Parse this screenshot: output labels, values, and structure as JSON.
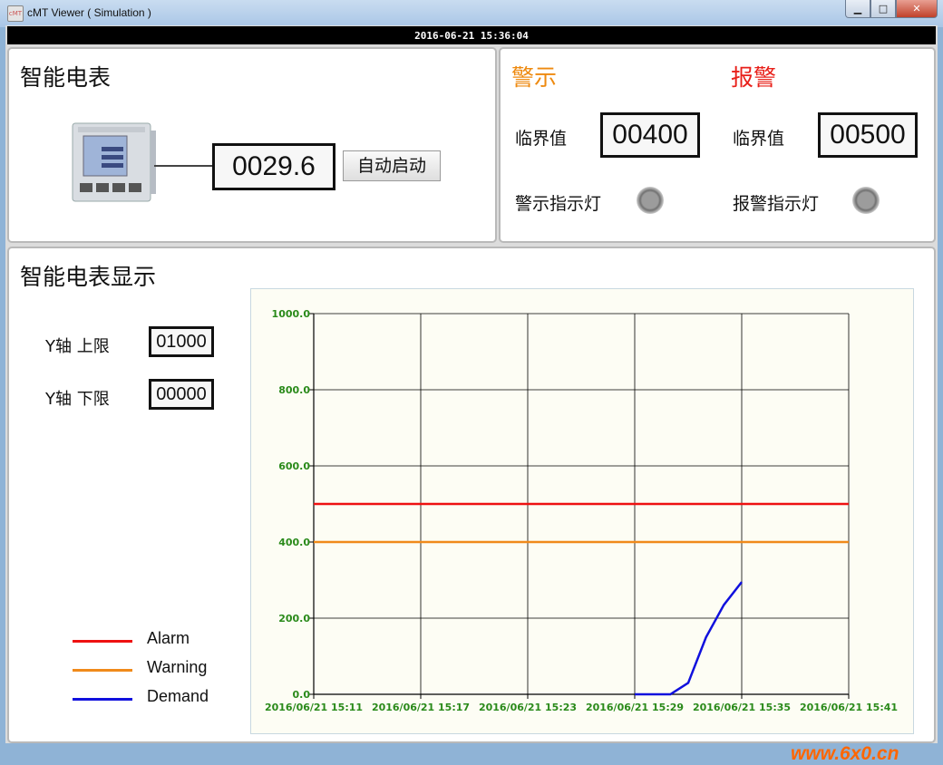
{
  "window": {
    "title": "cMT Viewer ( Simulation )",
    "icon": "cmt-app-icon"
  },
  "window_controls": {
    "minimize": "▁",
    "maximize": "□",
    "close": "✕"
  },
  "status_bar": {
    "datetime": "2016-06-21  15:36:04"
  },
  "meter_panel": {
    "title": "智能电表",
    "reading": "0029.6",
    "start_button": "自动启动",
    "device_image": "smart-power-meter"
  },
  "alert_panel": {
    "warning": {
      "title": "警示",
      "threshold_label": "临界值",
      "threshold_value": "00400",
      "lamp_label": "警示指示灯",
      "color": "#ee8a10"
    },
    "alarm": {
      "title": "报警",
      "threshold_label": "临界值",
      "threshold_value": "00500",
      "lamp_label": "报警指示灯",
      "color": "#e8201a"
    }
  },
  "trend_panel": {
    "title": "智能电表显示",
    "y_upper_label": "Y轴 上限",
    "y_upper_value": "01000",
    "y_lower_label": "Y轴 下限",
    "y_lower_value": "00000",
    "legend": [
      {
        "name": "Alarm",
        "color": "#ee1111"
      },
      {
        "name": "Warning",
        "color": "#f08a1a"
      },
      {
        "name": "Demand",
        "color": "#1010dd"
      }
    ]
  },
  "chart_data": {
    "type": "line",
    "title": "",
    "ylim": [
      0,
      1000
    ],
    "y_ticks": [
      "0.0",
      "200.0",
      "400.0",
      "600.0",
      "800.0",
      "1000.0"
    ],
    "x_ticks": [
      "2016/06/21 15:11",
      "2016/06/21 15:17",
      "2016/06/21 15:23",
      "2016/06/21 15:29",
      "2016/06/21 15:35",
      "2016/06/21 15:41"
    ],
    "xlim_minutes": [
      0,
      30
    ],
    "grid": true,
    "tick_color": "#2a8a1a",
    "series": [
      {
        "name": "Alarm",
        "color": "#ee1111",
        "x": [
          0,
          30
        ],
        "values": [
          500,
          500
        ]
      },
      {
        "name": "Warning",
        "color": "#f08a1a",
        "x": [
          0,
          30
        ],
        "values": [
          400,
          400
        ]
      },
      {
        "name": "Demand",
        "color": "#1010dd",
        "x": [
          18,
          19,
          20,
          21,
          22,
          23,
          24
        ],
        "values": [
          0,
          0,
          0,
          30,
          150,
          235,
          295
        ]
      }
    ]
  },
  "watermark": "www.6x0.cn"
}
